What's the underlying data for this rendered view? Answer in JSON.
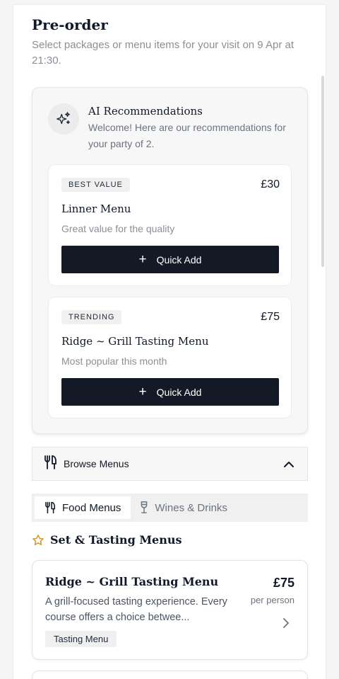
{
  "header": {
    "title": "Pre-order",
    "subtitle": "Select packages or menu items for your visit on 9 Apr at 21:30."
  },
  "ai": {
    "icon": "sparkles-icon",
    "title": "AI Recommendations",
    "description": "Welcome! Here are our recommendations for your party of 2.",
    "recommendations": [
      {
        "badge": "BEST VALUE",
        "price": "£30",
        "name": "Linner Menu",
        "description": "Great value for the quality",
        "button_label": "Quick Add",
        "button_icon": "+"
      },
      {
        "badge": "TRENDING",
        "price": "£75",
        "name": "Ridge ~ Grill Tasting Menu",
        "description": "Most popular this month",
        "button_label": "Quick Add",
        "button_icon": "+"
      }
    ]
  },
  "browse": {
    "label": "Browse Menus",
    "icon": "cutlery-icon",
    "toggle_icon": "chevron-up-icon"
  },
  "tabs": [
    {
      "label": "Food Menus",
      "icon": "cutlery-icon",
      "active": true
    },
    {
      "label": "Wines & Drinks",
      "icon": "wine-glass-icon",
      "active": false
    }
  ],
  "section": {
    "icon": "star-icon",
    "title": "Set & Tasting Menus"
  },
  "menu_items": [
    {
      "name": "Ridge ~ Grill Tasting Menu",
      "description": "A grill-focused tasting experience. Every course offers a choice betwee...",
      "price": "£75",
      "price_unit": "per person",
      "tag": "Tasting Menu"
    }
  ],
  "colors": {
    "primary_button": "#141a25",
    "star_accent": "#d49a2a",
    "muted_text": "#8a8f98"
  }
}
